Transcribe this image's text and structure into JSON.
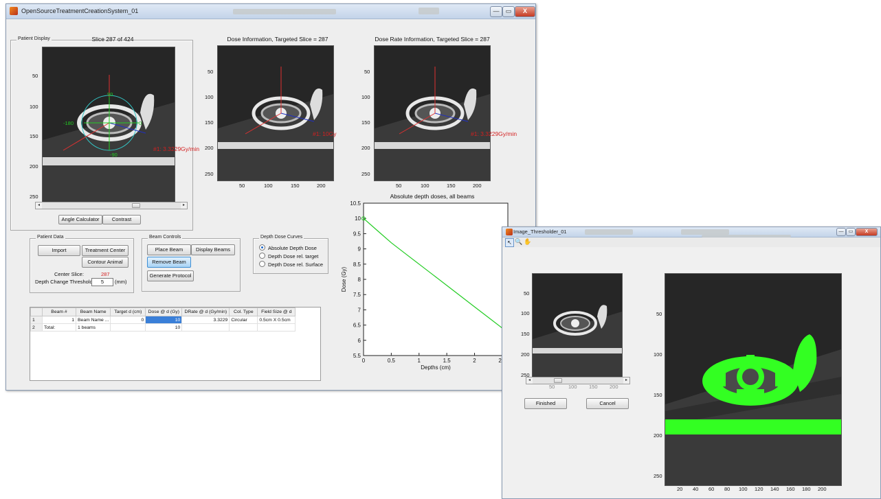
{
  "main_window": {
    "title": "OpenSourceTreatmentCreationSystem_01",
    "controls": {
      "minimize": "—",
      "maximize": "▭",
      "close": "X"
    }
  },
  "patient_display": {
    "panel_title": "Patient Display",
    "slice_label": "Slice 287 of 424",
    "y_ticks": [
      "50",
      "100",
      "150",
      "200",
      "250"
    ],
    "annotations": {
      "top": "90",
      "left": "-180",
      "right": "0",
      "bottom": "-90",
      "beam": "#1: 3.3229Gy/min"
    },
    "angle_calculator": "Angle Calculator",
    "contrast": "Contrast"
  },
  "dose_info": {
    "title": "Dose Information, Targeted Slice = 287",
    "y_ticks": [
      "50",
      "100",
      "150",
      "200",
      "250"
    ],
    "x_ticks": [
      "50",
      "100",
      "150",
      "200"
    ],
    "beam_label": "#1: 10Gy"
  },
  "dose_rate_info": {
    "title": "Dose Rate Information, Targeted Slice = 287",
    "y_ticks": [
      "50",
      "100",
      "150",
      "200",
      "250"
    ],
    "x_ticks": [
      "50",
      "100",
      "150",
      "200"
    ],
    "beam_label": "#1: 3.3229Gy/min"
  },
  "patient_data": {
    "panel_title": "Patient Data",
    "import": "Import",
    "treatment_center": "Treatment Center",
    "contour_animal": "Contour Animal",
    "center_slice_label": "Center Slice:",
    "center_slice_value": "287",
    "threshold_label": "Depth Change Threshold:",
    "threshold_value": "5",
    "threshold_unit": "(mm)"
  },
  "beam_controls": {
    "panel_title": "Beam Controls",
    "place_beam": "Place Beam",
    "display_beams": "Display Beams",
    "remove_beam": "Remove Beam",
    "generate_protocol": "Generate Protocol"
  },
  "depth_dose_curves": {
    "panel_title": "Depth Dose Curves",
    "options": [
      {
        "label": "Absolute Depth Dose",
        "selected": true
      },
      {
        "label": "Depth Dose rel. target",
        "selected": false
      },
      {
        "label": "Depth Dose rel. Surface",
        "selected": false
      }
    ]
  },
  "beam_table": {
    "headers": [
      "",
      "Beam #",
      "Beam Name",
      "Target d (cm)",
      "Dose @ d (Gy)",
      "DRate @ d (Gy/min)",
      "Col. Type",
      "Field Size @ d"
    ],
    "rows": [
      [
        "1",
        "1",
        "Beam Name ...",
        "0",
        "10",
        "3.3229",
        "Circular",
        "0.5cm X 0.5cm"
      ],
      [
        "2",
        "Total:",
        "1 beams",
        "",
        "10",
        "",
        "",
        ""
      ]
    ]
  },
  "chart_data": {
    "type": "line",
    "title": "Absolute depth doses, all beams",
    "xlabel": "Depths (cm)",
    "ylabel": "Dose (Gy)",
    "xlim": [
      0,
      2.6
    ],
    "ylim": [
      5.5,
      10.5
    ],
    "x_ticks": [
      "0",
      "0.5",
      "1",
      "1.5",
      "2",
      "2.5"
    ],
    "y_ticks": [
      "5.5",
      "6",
      "6.5",
      "7",
      "7.5",
      "8",
      "8.5",
      "9",
      "9.5",
      "10",
      "10.5"
    ],
    "series": [
      {
        "color": "#22cc22",
        "x": [
          0,
          0.25,
          0.5,
          0.75,
          1.0,
          1.25,
          1.5,
          1.75,
          2.0,
          2.25,
          2.5,
          2.6
        ],
        "y": [
          10.0,
          9.6,
          9.2,
          8.85,
          8.5,
          8.15,
          7.8,
          7.45,
          7.1,
          6.75,
          6.4,
          6.15
        ]
      }
    ],
    "marker": {
      "x": 0,
      "y": 10,
      "color": "#22cc22"
    }
  },
  "thresholder_window": {
    "title": "Image_Thresholder_01",
    "controls": {
      "minimize": "—",
      "maximize": "▭",
      "close": "X"
    },
    "tools": [
      "arrow",
      "zoom",
      "pan"
    ],
    "small_y_ticks": [
      "50",
      "100",
      "150",
      "200",
      "250"
    ],
    "small_x_ticks": [
      "50",
      "100",
      "150",
      "200"
    ],
    "finished": "Finished",
    "cancel": "Cancel",
    "large_y_ticks": [
      "50",
      "100",
      "150",
      "200",
      "250"
    ],
    "large_x_ticks": [
      "20",
      "40",
      "60",
      "80",
      "100",
      "120",
      "140",
      "160",
      "180",
      "200"
    ],
    "threshold_color": "#33ff22"
  }
}
